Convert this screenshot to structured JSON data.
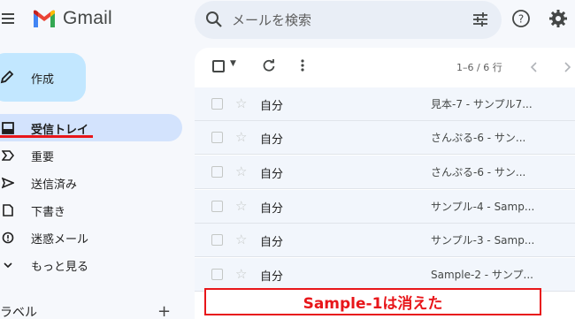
{
  "header": {
    "app_name": "Gmail",
    "search_placeholder": "メールを検索"
  },
  "sidebar": {
    "compose_label": "作成",
    "items": [
      {
        "label": "受信トレイ",
        "icon": "inbox-icon",
        "active": true
      },
      {
        "label": "重要",
        "icon": "important-icon",
        "active": false
      },
      {
        "label": "送信済み",
        "icon": "send-icon",
        "active": false
      },
      {
        "label": "下書き",
        "icon": "draft-icon",
        "active": false
      },
      {
        "label": "迷惑メール",
        "icon": "spam-icon",
        "active": false
      },
      {
        "label": "もっと見る",
        "icon": "expand-more-icon",
        "active": false
      }
    ],
    "labels_heading": "ラベル",
    "add_label": "+"
  },
  "toolbar": {
    "page_counter": "1–6 / 6 行"
  },
  "emails": [
    {
      "sender": "自分",
      "subject": "見本-7 - サンプル7..."
    },
    {
      "sender": "自分",
      "subject": "さんぷる-6 - サン..."
    },
    {
      "sender": "自分",
      "subject": "さんぷる-6 - サン..."
    },
    {
      "sender": "自分",
      "subject": "サンプル-4 - Samp..."
    },
    {
      "sender": "自分",
      "subject": "サンプル-3 - Samp..."
    },
    {
      "sender": "自分",
      "subject": "Sample-2 - サンプ..."
    }
  ],
  "annotation": {
    "text": "Sample-1は消えた",
    "color": "#e8161a"
  },
  "colors": {
    "active_nav_bg": "#d3e3fd",
    "compose_bg": "#c2e7ff",
    "search_bg": "#e9eef6"
  }
}
